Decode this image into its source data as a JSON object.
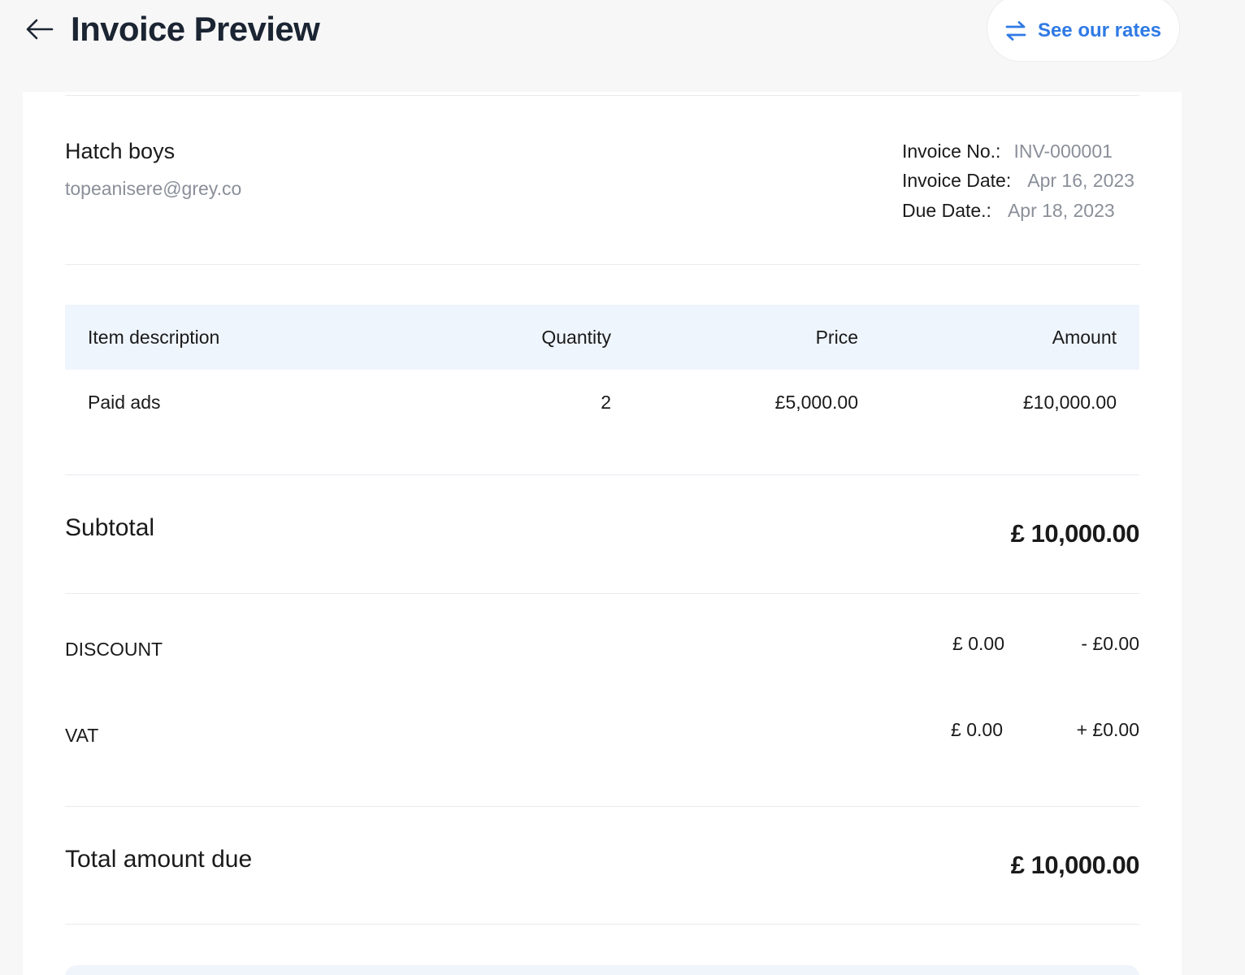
{
  "header": {
    "back_icon": "arrow-left-icon",
    "title": "Invoice Preview",
    "rates_button": {
      "icon": "swap-arrows-icon",
      "label": "See our rates",
      "color": "#2f7ae5"
    }
  },
  "client": {
    "name": "Hatch boys",
    "email": "topeanisere@grey.co"
  },
  "invoice_meta": {
    "number_label": "Invoice No.:",
    "number_value": "INV-000001",
    "date_label": "Invoice Date:",
    "date_value": "Apr 16, 2023",
    "due_label": "Due Date.:",
    "due_value": "Apr 18, 2023"
  },
  "items_table": {
    "headers": {
      "description": "Item description",
      "quantity": "Quantity",
      "price": "Price",
      "amount": "Amount"
    },
    "rows": [
      {
        "description": "Paid ads",
        "quantity": "2",
        "price": "£5,000.00",
        "amount": "£10,000.00"
      }
    ],
    "header_bg": "#eff5fd"
  },
  "summary": {
    "subtotal_label": "Subtotal",
    "subtotal_value": "£ 10,000.00",
    "discount_label": "DISCOUNT",
    "discount_rate": "£ 0.00",
    "discount_amount": "- £0.00",
    "vat_label": "VAT",
    "vat_rate": "£ 0.00",
    "vat_amount": "+ £0.00",
    "total_label": "Total amount due",
    "total_value": "£ 10,000.00"
  }
}
